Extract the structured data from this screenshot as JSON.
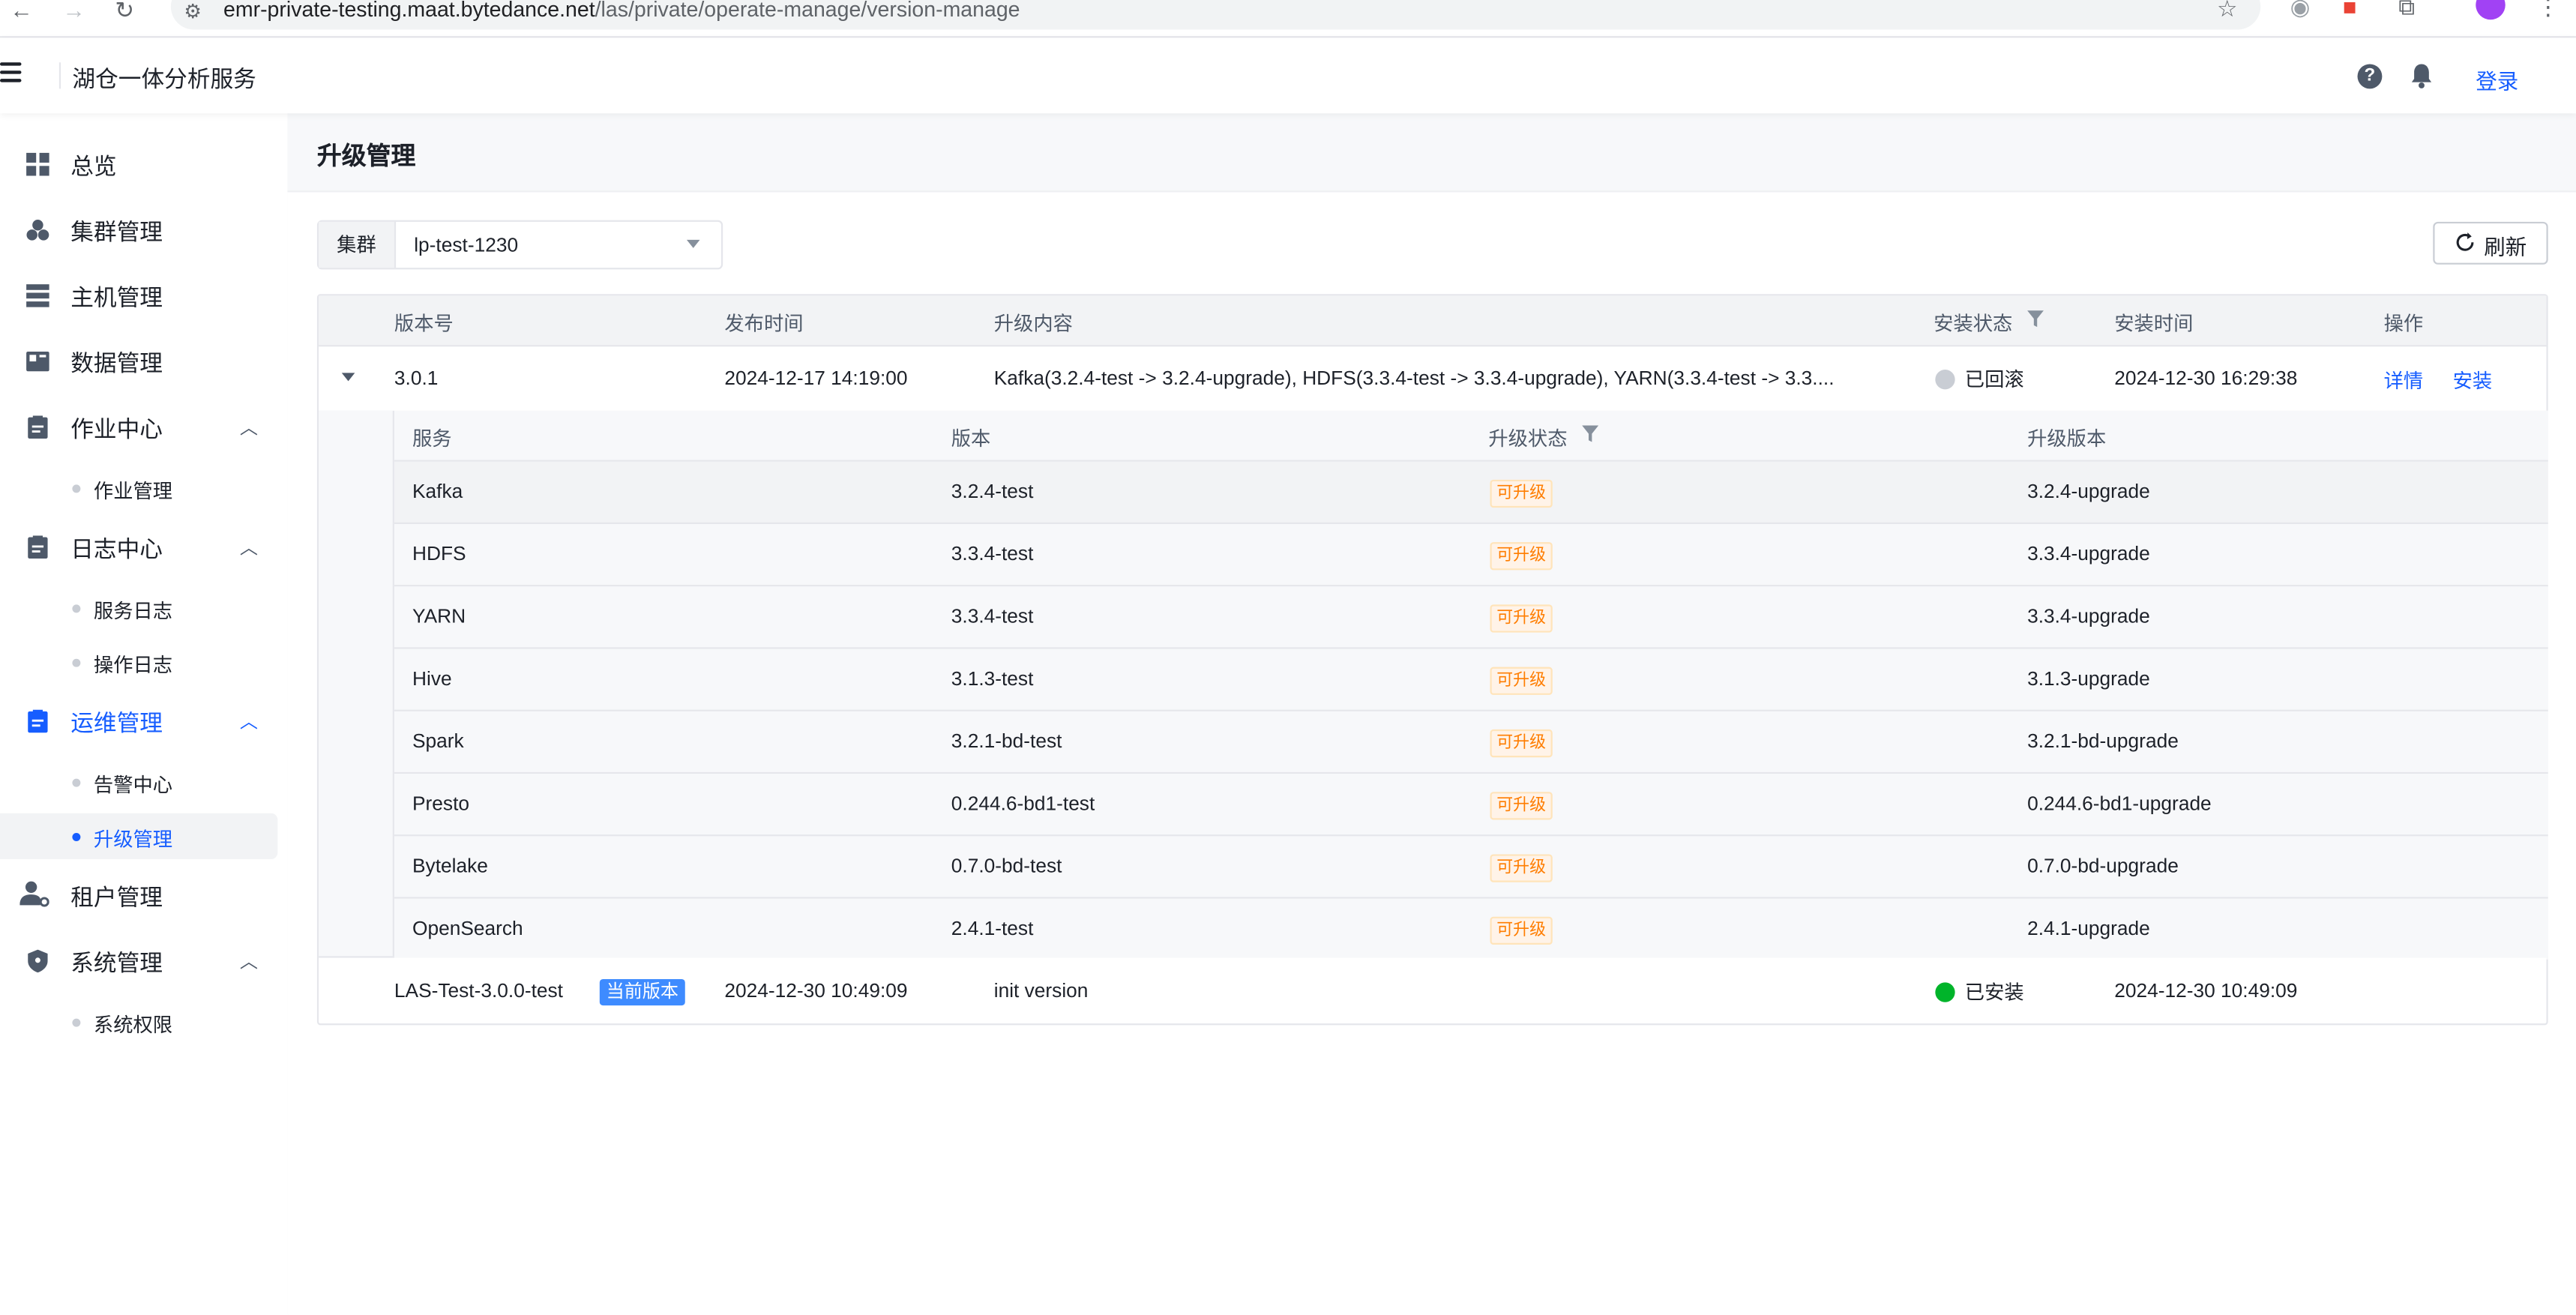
{
  "browser": {
    "url_host": "emr-private-testing.maat.bytedance.net",
    "url_path": "/las/private/operate-manage/version-manage"
  },
  "header": {
    "app_title": "湖仓一体分析服务",
    "help_glyph": "?",
    "login_label": "登录"
  },
  "sidebar": {
    "overview": "总览",
    "cluster": "集群管理",
    "host": "主机管理",
    "data": "数据管理",
    "job_center": "作业中心",
    "job_manage": "作业管理",
    "log_center": "日志中心",
    "service_log": "服务日志",
    "operate_log": "操作日志",
    "ops_manage": "运维管理",
    "alert_center": "告警中心",
    "upgrade_manage": "升级管理",
    "tenant": "租户管理",
    "system": "系统管理",
    "system_perm": "系统权限"
  },
  "page": {
    "title": "升级管理",
    "cluster_label": "集群",
    "cluster_value": "lp-test-1230",
    "refresh_label": "刷新"
  },
  "table": {
    "columns": [
      "版本号",
      "发布时间",
      "升级内容",
      "安装状态",
      "安装时间",
      "操作"
    ],
    "rows": [
      {
        "version": "3.0.1",
        "release_time": "2024-12-17 14:19:00",
        "content": "Kafka(3.2.4-test -> 3.2.4-upgrade), HDFS(3.3.4-test -> 3.3.4-upgrade), YARN(3.3.4-test -> 3.3....",
        "status": "已回滚",
        "install_time": "2024-12-30 16:29:38",
        "action_detail": "详情",
        "action_install": "安装"
      },
      {
        "version": "LAS-Test-3.0.0-test",
        "tag": "当前版本",
        "release_time": "2024-12-30 10:49:09",
        "content": "init version",
        "status": "已安装",
        "install_time": "2024-12-30 10:49:09"
      }
    ]
  },
  "nested": {
    "columns": [
      "服务",
      "版本",
      "升级状态",
      "升级版本"
    ],
    "rows": [
      {
        "service": "Kafka",
        "version": "3.2.4-test",
        "status": "可升级",
        "target": "3.2.4-upgrade"
      },
      {
        "service": "HDFS",
        "version": "3.3.4-test",
        "status": "可升级",
        "target": "3.3.4-upgrade"
      },
      {
        "service": "YARN",
        "version": "3.3.4-test",
        "status": "可升级",
        "target": "3.3.4-upgrade"
      },
      {
        "service": "Hive",
        "version": "3.1.3-test",
        "status": "可升级",
        "target": "3.1.3-upgrade"
      },
      {
        "service": "Spark",
        "version": "3.2.1-bd-test",
        "status": "可升级",
        "target": "3.2.1-bd-upgrade"
      },
      {
        "service": "Presto",
        "version": "0.244.6-bd1-test",
        "status": "可升级",
        "target": "0.244.6-bd1-upgrade"
      },
      {
        "service": "Bytelake",
        "version": "0.7.0-bd-test",
        "status": "可升级",
        "target": "0.7.0-bd-upgrade"
      },
      {
        "service": "OpenSearch",
        "version": "2.4.1-test",
        "status": "可升级",
        "target": "2.4.1-upgrade"
      }
    ]
  },
  "colors": {
    "primary": "#165dff",
    "warning": "#ff7d00",
    "success": "#00b42a"
  }
}
